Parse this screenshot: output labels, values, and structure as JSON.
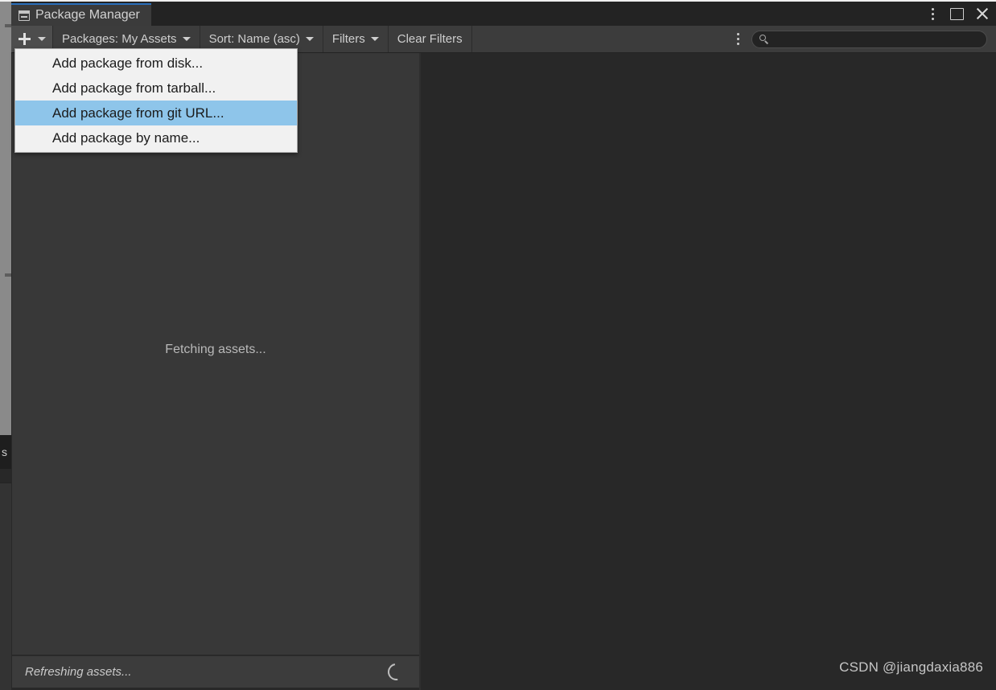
{
  "window": {
    "tab_label": "Package Manager",
    "tab_icon": "package-icon",
    "controls": {
      "menu_icon": "kebab-menu-icon",
      "maximize_icon": "maximize-icon",
      "close_icon": "close-icon"
    },
    "accent_color": "#2a6fbb",
    "titlebar_color": "#232323"
  },
  "toolbar": {
    "add_button": {
      "icon": "plus-icon",
      "dropdown_icon": "chevron-down-icon",
      "active": true
    },
    "packages_filter": "Packages: My Assets",
    "sort": "Sort: Name (asc)",
    "filters": "Filters",
    "clear_filters": "Clear Filters",
    "overflow_icon": "kebab-menu-icon",
    "search": {
      "icon": "search-icon",
      "value": "",
      "placeholder": ""
    }
  },
  "add_menu": {
    "visible": true,
    "highlight_color": "#8ec5ea",
    "items": [
      {
        "label": "Add package from disk...",
        "selected": false
      },
      {
        "label": "Add package from tarball...",
        "selected": false
      },
      {
        "label": "Add package from git URL...",
        "selected": true
      },
      {
        "label": "Add package by name...",
        "selected": false
      }
    ]
  },
  "left_panel": {
    "message": "Fetching assets..."
  },
  "right_panel": {
    "message": ""
  },
  "statusbar": {
    "text": "Refreshing assets...",
    "spinner_icon": "loading-spinner-icon"
  },
  "background": {
    "fragment_text": "s",
    "shape_red": "#a84c4c",
    "shape_yellow": "#c9a63c",
    "backdrop_gray": "#7d7d7d"
  },
  "watermark": {
    "text": "CSDN @jiangdaxia886"
  }
}
